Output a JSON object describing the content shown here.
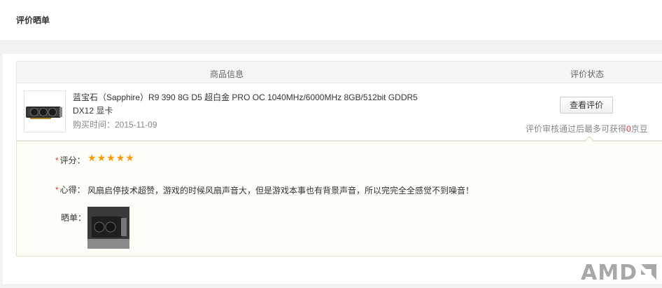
{
  "header": {
    "title": "评价晒单"
  },
  "table": {
    "col_product": "商品信息",
    "col_status": "评价状态"
  },
  "product": {
    "title": "蓝宝石（Sapphire）R9 390 8G D5 超白金 PRO OC 1040MHz/6000MHz 8GB/512bit GDDR5 DX12 显卡",
    "buy_date": "购买时间：2015-11-09",
    "thumbnail_icon": "graphics-card-image"
  },
  "status": {
    "view_button": "查看评价",
    "note_before": "评价审核通过后最多可获得",
    "note_count": "0",
    "note_after": "京豆",
    "highlight_color": "#e4393c"
  },
  "review": {
    "required_mark": "*",
    "rating_label": "评分：",
    "rating": 5,
    "rating_max": 5,
    "comment_label": "心得：",
    "comment": "风扇启停技术超赞，游戏的时候风扇声音大，但是游戏本事也有背景声音，所以完完全全感觉不到噪音！",
    "photo_label": "晒单："
  },
  "watermark": {
    "text": "AMD"
  }
}
